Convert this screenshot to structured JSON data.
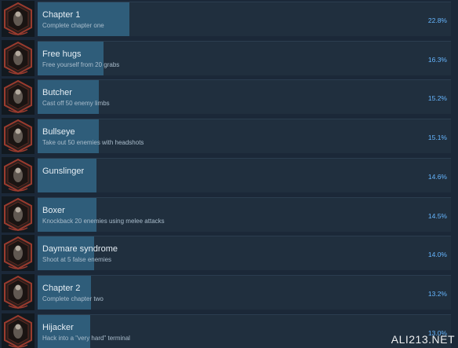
{
  "achievements": [
    {
      "title": "Chapter 1",
      "description": "Complete chapter one",
      "percent_text": "22.8%",
      "percent": 22.8,
      "icon": "skull-mask-icon"
    },
    {
      "title": "Free hugs",
      "description": "Free yourself from 20 grabs",
      "percent_text": "16.3%",
      "percent": 16.3,
      "icon": "grabbing-hand-icon"
    },
    {
      "title": "Butcher",
      "description": "Cast off 50 enemy limbs",
      "percent_text": "15.2%",
      "percent": 15.2,
      "icon": "severed-limb-icon"
    },
    {
      "title": "Bullseye",
      "description": "Take out 50 enemies with headshots",
      "percent_text": "15.1%",
      "percent": 15.1,
      "icon": "skull-target-icon"
    },
    {
      "title": "Gunslinger",
      "description": "",
      "percent_text": "14.6%",
      "percent": 14.6,
      "icon": "pistol-icon"
    },
    {
      "title": "Boxer",
      "description": "Knockback 20 enemies using melee attacks",
      "percent_text": "14.5%",
      "percent": 14.5,
      "icon": "fist-icon"
    },
    {
      "title": "Daymare syndrome",
      "description": "Shoot at 5 false enemies",
      "percent_text": "14.0%",
      "percent": 14.0,
      "icon": "zombie-figure-icon"
    },
    {
      "title": "Chapter 2",
      "description": "Complete chapter two",
      "percent_text": "13.2%",
      "percent": 13.2,
      "icon": "red-eyes-face-icon"
    },
    {
      "title": "Hijacker",
      "description": "Hack into a \"very hard\" terminal",
      "percent_text": "13.0%",
      "percent": 13.0,
      "icon": "terminal-hand-icon"
    }
  ],
  "colors": {
    "background": "#1b2838",
    "panel": "#202f3e",
    "progress_fill": "#2f5d7a",
    "percent_text": "#66b6ff",
    "icon_border": "#9a3b2e",
    "icon_inner": "#2a1e1c"
  },
  "watermark": "ALI213.NET"
}
